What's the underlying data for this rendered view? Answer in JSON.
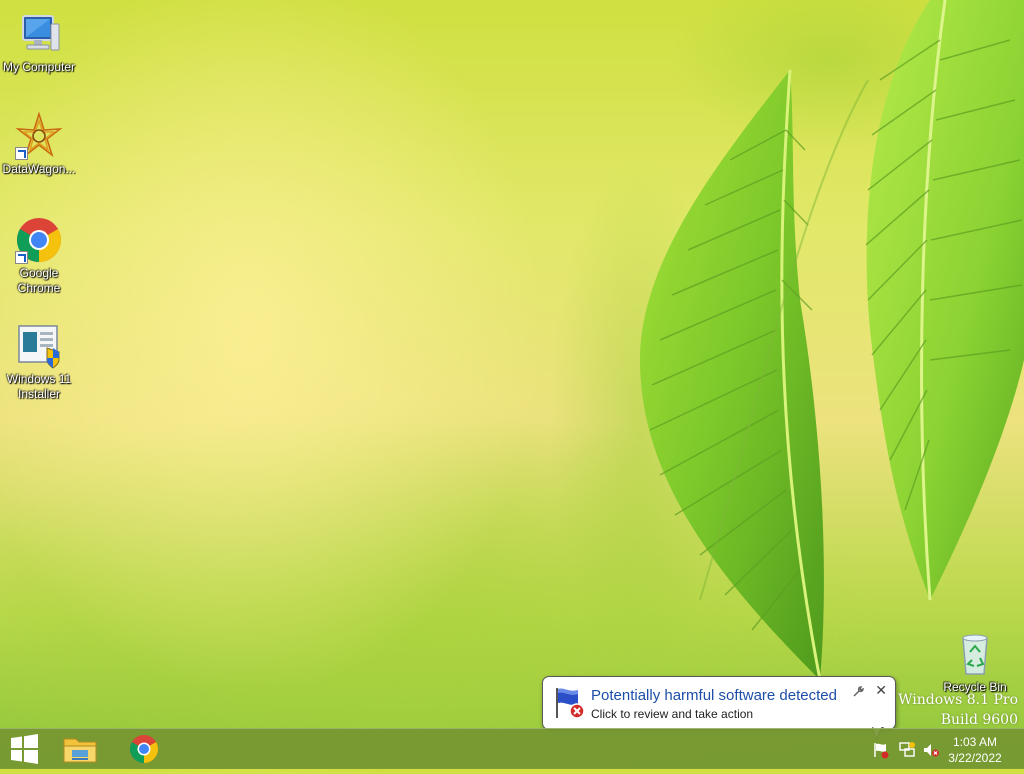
{
  "desktop": {
    "icons": [
      {
        "label": "My Computer"
      },
      {
        "label": "DataWagon..."
      },
      {
        "label_line1": "Google",
        "label_line2": "Chrome"
      },
      {
        "label_line1": "Windows 11",
        "label_line2": "Installer"
      }
    ],
    "recycle_bin": {
      "label": "Recycle Bin"
    }
  },
  "watermark": {
    "line1": "Windows 8.1 Pro",
    "line2": "Build 9600"
  },
  "notification": {
    "title": "Potentially harmful software detected",
    "body": "Click to review and take action",
    "close_glyph": "✕"
  },
  "taskbar": {
    "pinned": [
      {
        "icon": "file-explorer-icon"
      },
      {
        "icon": "chrome-icon"
      }
    ],
    "tray_icons": [
      "action-center-flag-icon",
      "network-icon",
      "volume-muted-icon"
    ],
    "clock": {
      "time": "1:03 AM",
      "date": "3/22/2022"
    }
  },
  "colors": {
    "accent": "#1d4fa8",
    "taskbar": "#76963280"
  }
}
